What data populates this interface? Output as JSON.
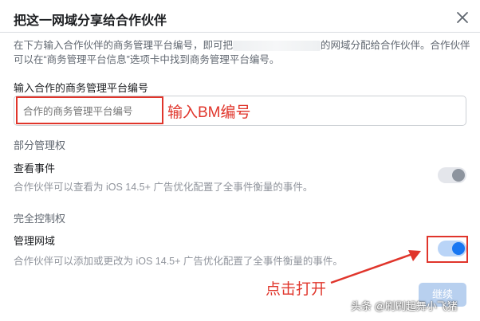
{
  "dialog": {
    "title": "把这一网域分享给合作伙伴",
    "description_before": "在下方输入合作伙伴的商务管理平台编号，即可把",
    "description_after": "的网域分配给合作伙伴。合作伙伴可以在“商务管理平台信息”选项卡中找到商务管理平台编号。",
    "input_label": "输入合作的商务管理平台编号",
    "input_placeholder": "合作的商务管理平台编号",
    "partial_section": "部分管理权",
    "view_events_title": "查看事件",
    "view_events_desc": "合作伙伴可以查看为 iOS 14.5+ 广告优化配置了全事件衡量的事件。",
    "full_section": "完全控制权",
    "manage_domain_title": "管理网域",
    "manage_domain_desc": "合作伙伴可以添加或更改为 iOS 14.5+ 广告优化配置了全事件衡量的事件。",
    "continue_label": "继续"
  },
  "annotations": {
    "input_note": "输入BM编号",
    "toggle_note": "点击打开"
  },
  "watermark": "头条 @刷刷起舞小飞猪",
  "colors": {
    "accent": "#1877f2",
    "annotation_red": "#e0352b"
  },
  "toggles": {
    "view_events": false,
    "manage_domain": true
  }
}
